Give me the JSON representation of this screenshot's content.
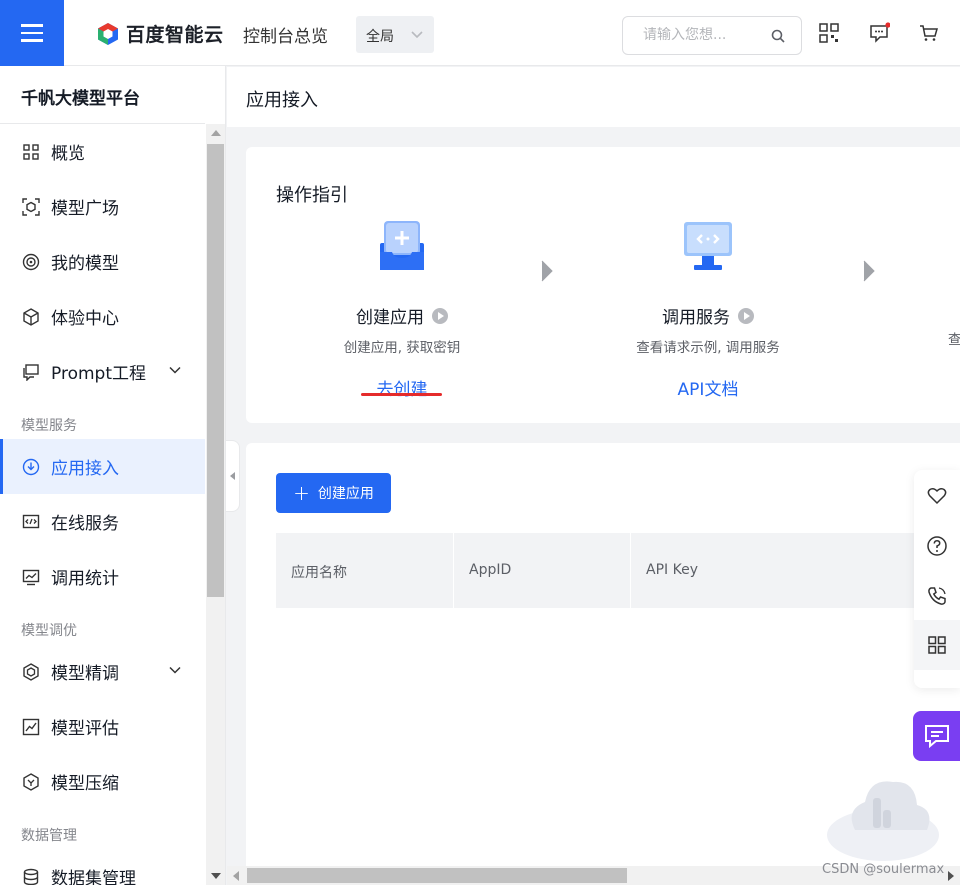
{
  "topbar": {
    "brand": "百度智能云",
    "console_title": "控制台总览",
    "region": "全局",
    "search_placeholder": "请输入您想..."
  },
  "sidebar": {
    "platform_title": "千帆大模型平台",
    "items": [
      {
        "label": "概览",
        "icon": "grid-icon"
      },
      {
        "label": "模型广场",
        "icon": "cube-scan-icon"
      },
      {
        "label": "我的模型",
        "icon": "target-icon"
      },
      {
        "label": "体验中心",
        "icon": "hexagon-cube-icon"
      },
      {
        "label": "Prompt工程",
        "icon": "chat-box-icon",
        "expandable": true
      }
    ],
    "group_service": "模型服务",
    "service_items": [
      {
        "label": "应用接入",
        "icon": "download-circle-icon",
        "active": true
      },
      {
        "label": "在线服务",
        "icon": "code-window-icon"
      },
      {
        "label": "调用统计",
        "icon": "chart-window-icon"
      }
    ],
    "group_tuning": "模型调优",
    "tuning_items": [
      {
        "label": "模型精调",
        "icon": "gear-hexagon-icon",
        "expandable": true
      },
      {
        "label": "模型评估",
        "icon": "trend-box-icon"
      },
      {
        "label": "模型压缩",
        "icon": "compress-hexagon-icon"
      }
    ],
    "group_data": "数据管理",
    "data_items": [
      {
        "label": "数据集管理",
        "icon": "database-icon"
      }
    ]
  },
  "page": {
    "title": "应用接入"
  },
  "guide": {
    "title": "操作指引",
    "steps": [
      {
        "name": "创建应用",
        "desc": "创建应用, 获取密钥",
        "link": "去创建"
      },
      {
        "name": "调用服务",
        "desc": "查看请求示例, 调用服务",
        "link": "API文档"
      },
      {
        "desc_partial": "查"
      }
    ]
  },
  "table": {
    "create_button": "创建应用",
    "columns": [
      "应用名称",
      "AppID",
      "API Key"
    ]
  },
  "watermark": "CSDN @soulermax",
  "colors": {
    "primary": "#2468f2",
    "highlight_underline": "#e52b2b",
    "chat_button": "#7a3ef2"
  }
}
